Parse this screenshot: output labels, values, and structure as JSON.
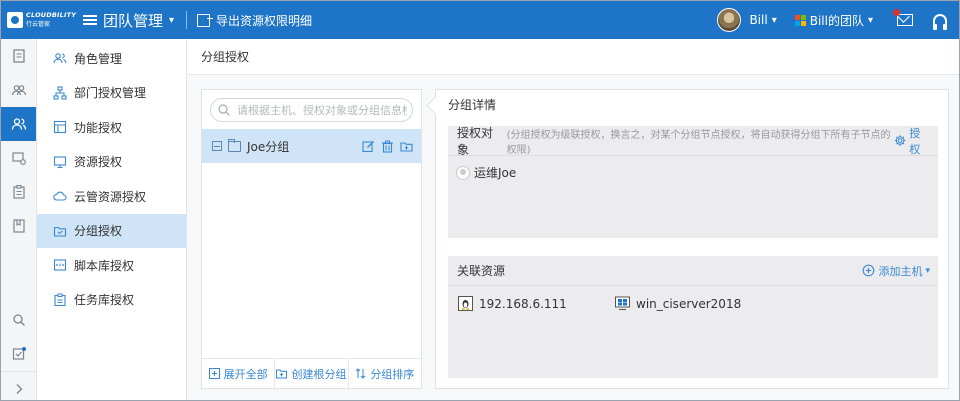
{
  "header": {
    "logo_en": "CLOUDBILITY",
    "logo_cn": "行云管家",
    "title": "团队管理",
    "export_label": "导出资源权限明细",
    "user_name": "Bill",
    "team_name": "Bill的团队"
  },
  "subnav": {
    "items": [
      {
        "label": "角色管理",
        "icon": "users-icon"
      },
      {
        "label": "部门授权管理",
        "icon": "org-chart-icon"
      },
      {
        "label": "功能授权",
        "icon": "function-grid-icon"
      },
      {
        "label": "资源授权",
        "icon": "monitor-icon"
      },
      {
        "label": "云管资源授权",
        "icon": "cloud-icon"
      },
      {
        "label": "分组授权",
        "icon": "folder-icon"
      },
      {
        "label": "脚本库授权",
        "icon": "script-icon"
      },
      {
        "label": "任务库授权",
        "icon": "task-icon"
      }
    ],
    "active_index": 5
  },
  "breadcrumb": "分组授权",
  "tree": {
    "search_placeholder": "请根据主机、授权对象或分组信息检索",
    "group_name": "Joe分组",
    "footer": {
      "expand_all": "展开全部",
      "create_root": "创建根分组",
      "sort": "分组排序"
    }
  },
  "detail": {
    "title": "分组详情",
    "auth": {
      "title": "授权对象",
      "hint": "(分组授权为级联授权，换言之，对某个分组节点授权，将自动获得分组下所有子节点的权限)",
      "action": "授权",
      "member": "运维Joe"
    },
    "resources": {
      "title": "关联资源",
      "action": "添加主机",
      "items": [
        {
          "name": "192.168.6.111",
          "icon": "linux-icon"
        },
        {
          "name": "win_ciserver2018",
          "icon": "windows-icon"
        }
      ]
    }
  },
  "colors": {
    "brand": "#1e74c7",
    "active_bg": "#cfe4f6",
    "link": "#3a88d4"
  }
}
